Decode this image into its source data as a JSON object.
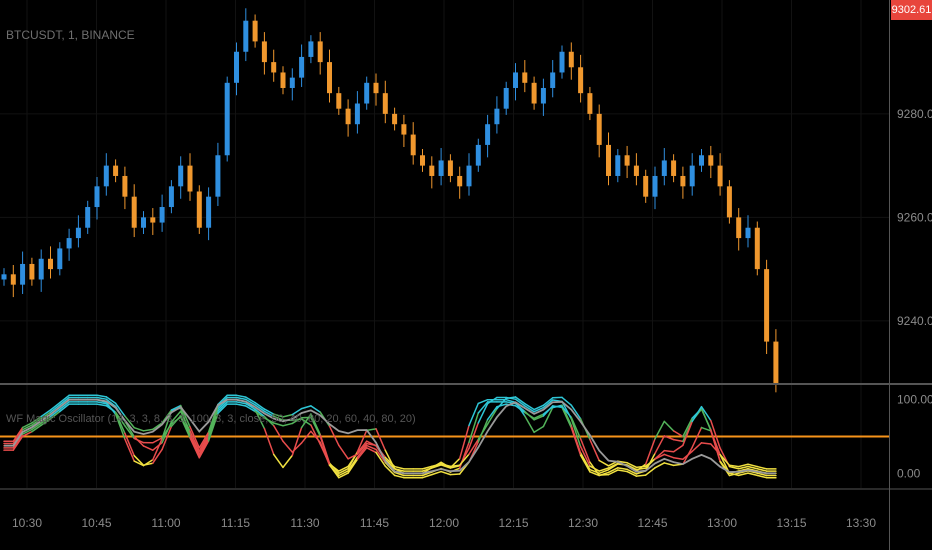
{
  "header": {
    "symbol_label": "BTCUSDT, 1, BINANCE",
    "last_price_badge": "9302.61"
  },
  "indicator": {
    "label": "WF Magic Oscillator (14, 3, 3, 8, 3, 3, 100, 3, 3, close, 50, 40, 80, 20, 60, 40, 80, 20)"
  },
  "colors": {
    "up_candle": "#2f8fe0",
    "down_candle": "#f0982e",
    "badge": "#e8453c",
    "ref_line": "#f7931a",
    "osc_cyan": "#2ec6d6",
    "osc_green": "#53b35a",
    "osc_red": "#e84c4c",
    "osc_yellow": "#f0e040",
    "osc_gray": "#9a9a9a"
  },
  "chart_data": [
    {
      "type": "candlestick",
      "title": "BTCUSDT, 1, BINANCE",
      "y_ticks": [
        "9240.00",
        "9260.00",
        "9280.00"
      ],
      "ylim": [
        9228,
        9302
      ],
      "x_ticks": [
        "10:30",
        "10:45",
        "11:00",
        "11:15",
        "11:30",
        "11:45",
        "12:00",
        "12:15",
        "12:30",
        "12:45",
        "13:00",
        "13:15",
        "13:30"
      ],
      "close": [
        9249,
        9247,
        9251,
        9248,
        9252,
        9250,
        9254,
        9256,
        9258,
        9262,
        9266,
        9270,
        9268,
        9264,
        9258,
        9260,
        9259,
        9262,
        9266,
        9270,
        9265,
        9258,
        9264,
        9272,
        9286,
        9292,
        9298,
        9294,
        9290,
        9288,
        9285,
        9287,
        9291,
        9294,
        9290,
        9284,
        9281,
        9278,
        9282,
        9286,
        9284,
        9280,
        9278,
        9276,
        9272,
        9270,
        9268,
        9271,
        9268,
        9266,
        9270,
        9274,
        9278,
        9281,
        9285,
        9288,
        9286,
        9282,
        9285,
        9288,
        9292,
        9289,
        9284,
        9280,
        9274,
        9268,
        9272,
        9270,
        9268,
        9264,
        9268,
        9271,
        9268,
        9266,
        9270,
        9272,
        9270,
        9266,
        9260,
        9256,
        9258,
        9250,
        9236,
        9228
      ]
    },
    {
      "type": "line",
      "title": "WF Magic Oscillator",
      "y_ticks": [
        "100.00",
        "0.00"
      ],
      "ylim": [
        -20,
        120
      ],
      "reference_level": 50
    }
  ]
}
